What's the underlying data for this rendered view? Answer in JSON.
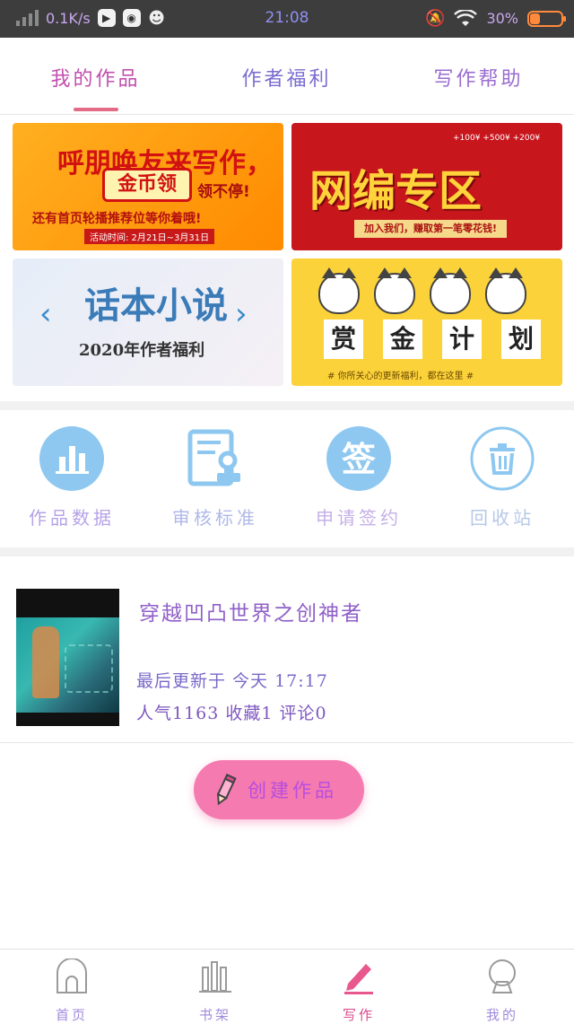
{
  "status_bar": {
    "net_speed": "0.1K/s",
    "time": "21:08",
    "battery": "30%",
    "battery_level": 0.3,
    "icons": [
      "signal-icon",
      "play-icon",
      "globe-icon",
      "qq-icon",
      "mute-icon",
      "wifi-icon",
      "battery-icon"
    ]
  },
  "tabs": [
    {
      "label": "我的作品",
      "active": true
    },
    {
      "label": "作者福利",
      "active": false
    },
    {
      "label": "写作帮助",
      "active": false
    }
  ],
  "banners": {
    "b1": {
      "title": "呼朋唤友来写作，",
      "coin": "金币领",
      "coin_suffix": "领不停!",
      "sub": "还有首页轮播推荐位等你着哦!",
      "date": "活动时间: 2月21日~3月31日"
    },
    "b2": {
      "title": "网编专区",
      "strip": "加入我们，赚取第一笔零花钱!",
      "coins": "+100¥  +500¥  +200¥"
    },
    "b3": {
      "title": "话本小说",
      "sub": "2020年作者福利"
    },
    "b4": {
      "cards": [
        "赏",
        "金",
        "计",
        "划"
      ],
      "note": "# 你所关心的更新福利，都在这里 #"
    }
  },
  "quick_actions": [
    {
      "label": "作品数据",
      "icon": "bar-chart-icon"
    },
    {
      "label": "审核标准",
      "icon": "document-stamp-icon"
    },
    {
      "label": "申请签约",
      "icon": "sign-icon"
    },
    {
      "label": "回收站",
      "icon": "trash-icon"
    }
  ],
  "work": {
    "title": "穿越凹凸世界之创神者",
    "updated": "最后更新于 今天 17:17",
    "stats": "人气1163 收藏1 评论0"
  },
  "create_button": {
    "label": "创建作品",
    "icon": "pencil-icon"
  },
  "bottom_nav": [
    {
      "label": "首页",
      "icon": "home-icon",
      "active": false
    },
    {
      "label": "书架",
      "icon": "bookshelf-icon",
      "active": false
    },
    {
      "label": "写作",
      "icon": "write-icon",
      "active": true
    },
    {
      "label": "我的",
      "icon": "user-icon",
      "active": false
    }
  ],
  "colors": {
    "accent_pink": "#f47ab0",
    "tab_underline": "#e36b87",
    "icon_blue": "#8ec8f0",
    "status_bar_bg": "#3d3d3d"
  }
}
